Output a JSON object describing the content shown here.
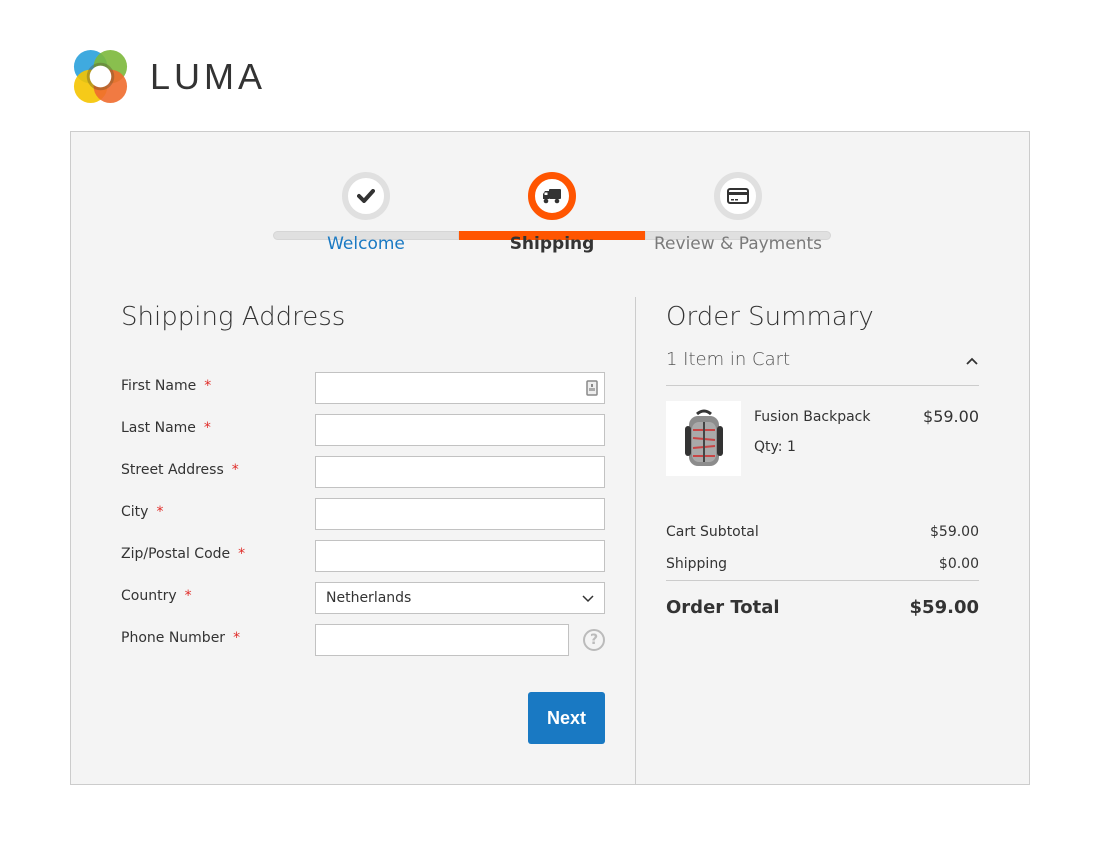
{
  "brand": {
    "name": "LUMA",
    "logo_icon": "luma-logo-icon"
  },
  "progress": {
    "steps": [
      {
        "label": "Welcome",
        "status": "complete",
        "icon": "checkmark-icon"
      },
      {
        "label": "Shipping",
        "status": "current",
        "icon": "truck-icon"
      },
      {
        "label": "Review & Payments",
        "status": "pending",
        "icon": "credit-card-icon"
      }
    ],
    "colors": {
      "active": "#ff5501",
      "complete_link": "#1979c3",
      "inactive": "#e0e0e0"
    }
  },
  "shipping_address": {
    "title": "Shipping Address",
    "required_marker": "*",
    "fields": [
      {
        "label": "First Name",
        "value": "",
        "type": "text",
        "has_autofill_icon": true
      },
      {
        "label": "Last Name",
        "value": "",
        "type": "text"
      },
      {
        "label": "Street Address",
        "value": "",
        "type": "text"
      },
      {
        "label": "City",
        "value": "",
        "type": "text"
      },
      {
        "label": "Zip/Postal Code",
        "value": "",
        "type": "text"
      },
      {
        "label": "Country",
        "value": "Netherlands",
        "type": "select"
      },
      {
        "label": "Phone Number",
        "value": "",
        "type": "text",
        "has_help_icon": true
      }
    ],
    "help_glyph": "?",
    "next_button": "Next",
    "button_color": "#1979c3"
  },
  "order_summary": {
    "title": "Order Summary",
    "cart_toggle": "1 Item in Cart",
    "items": [
      {
        "name": "Fusion Backpack",
        "qty_label": "Qty: 1",
        "price": "$59.00"
      }
    ],
    "totals": [
      {
        "label": "Cart Subtotal",
        "amount": "$59.00"
      },
      {
        "label": "Shipping",
        "amount": "$0.00"
      }
    ],
    "grand_total": {
      "label": "Order Total",
      "amount": "$59.00"
    }
  }
}
